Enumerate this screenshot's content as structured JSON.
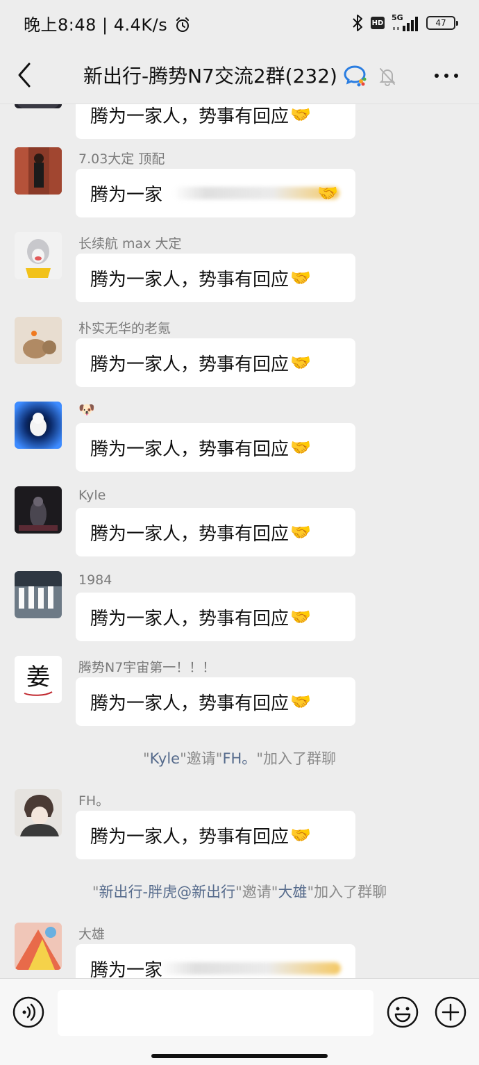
{
  "status_bar": {
    "time_and_speed": "晚上8:48 | 4.4K/s",
    "network": "5G",
    "hd": "HD",
    "battery": "47"
  },
  "nav": {
    "title": "新出行-腾势N7交流2群(232)"
  },
  "colors": {
    "background": "#ededed",
    "bubble": "#ffffff",
    "system_highlight": "#566b8c"
  },
  "messages": [
    {
      "sender": "",
      "text": "腾为一家人，势事有回应",
      "emoji": "🤝"
    },
    {
      "sender": "7.03大定 顶配",
      "text": "腾为一家",
      "emoji": "🤝"
    },
    {
      "sender": "长续航 max 大定",
      "text": "腾为一家人，势事有回应",
      "emoji": "🤝"
    },
    {
      "sender": "朴实无华的老氪",
      "text": "腾为一家人，势事有回应",
      "emoji": "🤝"
    },
    {
      "sender": "🐶",
      "text": "腾为一家人，势事有回应",
      "emoji": "🤝"
    },
    {
      "sender": "Kyle",
      "text": "腾为一家人，势事有回应",
      "emoji": "🤝"
    },
    {
      "sender": "1984",
      "text": "腾为一家人，势事有回应",
      "emoji": "🤝"
    },
    {
      "sender": "腾势N7宇宙第一！！！",
      "text": "腾为一家人，势事有回应",
      "emoji": "🤝",
      "avatar_char": "姜"
    },
    {
      "sender": "FH。",
      "text": "腾为一家人，势事有回应",
      "emoji": "🤝"
    },
    {
      "sender": "大雄",
      "text": "腾为一家"
    }
  ],
  "system_1": {
    "q1": "\"",
    "inviter": "Kyle",
    "q2": "\"邀请\"",
    "invitee": "FH。",
    "q3": "\"加入了群聊"
  },
  "system_2": {
    "q1": "\"",
    "inviter": "新出行-胖虎@新出行",
    "q2": "\"邀请\"",
    "invitee": "大雄",
    "q3": "\"加入了群聊"
  },
  "input": {
    "placeholder": ""
  },
  "icons": {
    "back": "back-arrow-icon",
    "wecom": "wecom-logo-icon",
    "mute": "bell-off-icon",
    "more": "more-dots-icon",
    "voice": "voice-icon",
    "emoji": "emoji-icon",
    "plus": "plus-icon"
  }
}
